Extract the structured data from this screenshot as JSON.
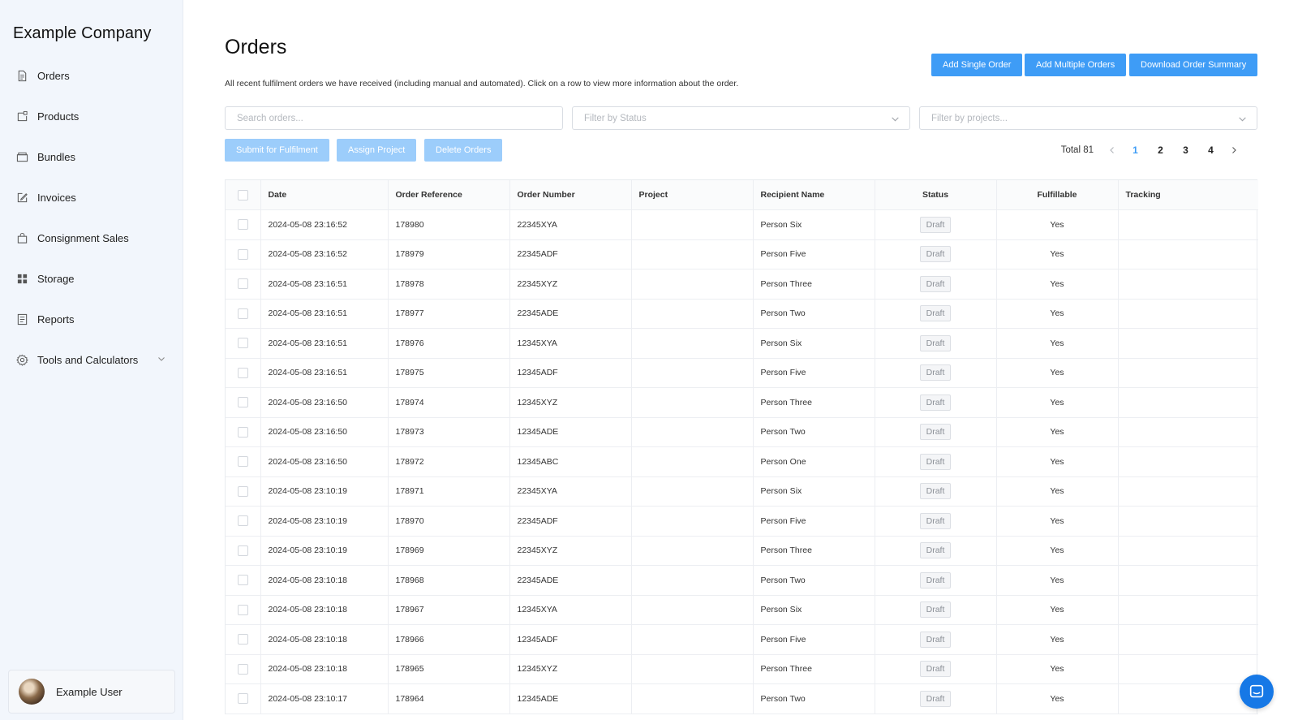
{
  "sidebar": {
    "company": "Example Company",
    "items": [
      {
        "label": "Orders",
        "icon": "document-icon"
      },
      {
        "label": "Products",
        "icon": "product-icon"
      },
      {
        "label": "Bundles",
        "icon": "box-icon"
      },
      {
        "label": "Invoices",
        "icon": "edit-icon"
      },
      {
        "label": "Consignment Sales",
        "icon": "bag-icon"
      },
      {
        "label": "Storage",
        "icon": "grid-icon"
      },
      {
        "label": "Reports",
        "icon": "report-icon"
      },
      {
        "label": "Tools and Calculators",
        "icon": "gear-icon"
      }
    ],
    "user": {
      "name": "Example User"
    }
  },
  "page": {
    "title": "Orders",
    "description": "All recent fulfilment orders we have received (including manual and automated). Click on a row to view more information about the order."
  },
  "actions": {
    "add_single": "Add Single Order",
    "add_multiple": "Add Multiple Orders",
    "download_summary": "Download Order Summary"
  },
  "filters": {
    "search_placeholder": "Search orders...",
    "status_placeholder": "Filter by Status",
    "projects_placeholder": "Filter by projects..."
  },
  "bulk": {
    "submit": "Submit for Fulfilment",
    "assign": "Assign Project",
    "delete": "Delete Orders"
  },
  "pagination": {
    "total": "Total 81",
    "pages": [
      "1",
      "2",
      "3",
      "4"
    ],
    "current": "1"
  },
  "table": {
    "columns": [
      "Date",
      "Order Reference",
      "Order Number",
      "Project",
      "Recipient Name",
      "Status",
      "Fulfillable",
      "Tracking"
    ],
    "rows": [
      {
        "date": "2024-05-08 23:16:52",
        "ref": "178980",
        "number": "22345XYA",
        "project": "",
        "recipient": "Person Six",
        "status": "Draft",
        "fulfillable": "Yes",
        "tracking": ""
      },
      {
        "date": "2024-05-08 23:16:52",
        "ref": "178979",
        "number": "22345ADF",
        "project": "",
        "recipient": "Person Five",
        "status": "Draft",
        "fulfillable": "Yes",
        "tracking": ""
      },
      {
        "date": "2024-05-08 23:16:51",
        "ref": "178978",
        "number": "22345XYZ",
        "project": "",
        "recipient": "Person Three",
        "status": "Draft",
        "fulfillable": "Yes",
        "tracking": ""
      },
      {
        "date": "2024-05-08 23:16:51",
        "ref": "178977",
        "number": "22345ADE",
        "project": "",
        "recipient": "Person Two",
        "status": "Draft",
        "fulfillable": "Yes",
        "tracking": ""
      },
      {
        "date": "2024-05-08 23:16:51",
        "ref": "178976",
        "number": "12345XYA",
        "project": "",
        "recipient": "Person Six",
        "status": "Draft",
        "fulfillable": "Yes",
        "tracking": ""
      },
      {
        "date": "2024-05-08 23:16:51",
        "ref": "178975",
        "number": "12345ADF",
        "project": "",
        "recipient": "Person Five",
        "status": "Draft",
        "fulfillable": "Yes",
        "tracking": ""
      },
      {
        "date": "2024-05-08 23:16:50",
        "ref": "178974",
        "number": "12345XYZ",
        "project": "",
        "recipient": "Person Three",
        "status": "Draft",
        "fulfillable": "Yes",
        "tracking": ""
      },
      {
        "date": "2024-05-08 23:16:50",
        "ref": "178973",
        "number": "12345ADE",
        "project": "",
        "recipient": "Person Two",
        "status": "Draft",
        "fulfillable": "Yes",
        "tracking": ""
      },
      {
        "date": "2024-05-08 23:16:50",
        "ref": "178972",
        "number": "12345ABC",
        "project": "",
        "recipient": "Person One",
        "status": "Draft",
        "fulfillable": "Yes",
        "tracking": ""
      },
      {
        "date": "2024-05-08 23:10:19",
        "ref": "178971",
        "number": "22345XYA",
        "project": "",
        "recipient": "Person Six",
        "status": "Draft",
        "fulfillable": "Yes",
        "tracking": ""
      },
      {
        "date": "2024-05-08 23:10:19",
        "ref": "178970",
        "number": "22345ADF",
        "project": "",
        "recipient": "Person Five",
        "status": "Draft",
        "fulfillable": "Yes",
        "tracking": ""
      },
      {
        "date": "2024-05-08 23:10:19",
        "ref": "178969",
        "number": "22345XYZ",
        "project": "",
        "recipient": "Person Three",
        "status": "Draft",
        "fulfillable": "Yes",
        "tracking": ""
      },
      {
        "date": "2024-05-08 23:10:18",
        "ref": "178968",
        "number": "22345ADE",
        "project": "",
        "recipient": "Person Two",
        "status": "Draft",
        "fulfillable": "Yes",
        "tracking": ""
      },
      {
        "date": "2024-05-08 23:10:18",
        "ref": "178967",
        "number": "12345XYA",
        "project": "",
        "recipient": "Person Six",
        "status": "Draft",
        "fulfillable": "Yes",
        "tracking": ""
      },
      {
        "date": "2024-05-08 23:10:18",
        "ref": "178966",
        "number": "12345ADF",
        "project": "",
        "recipient": "Person Five",
        "status": "Draft",
        "fulfillable": "Yes",
        "tracking": ""
      },
      {
        "date": "2024-05-08 23:10:18",
        "ref": "178965",
        "number": "12345XYZ",
        "project": "",
        "recipient": "Person Three",
        "status": "Draft",
        "fulfillable": "Yes",
        "tracking": ""
      },
      {
        "date": "2024-05-08 23:10:17",
        "ref": "178964",
        "number": "12345ADE",
        "project": "",
        "recipient": "Person Two",
        "status": "Draft",
        "fulfillable": "Yes",
        "tracking": ""
      }
    ]
  },
  "colors": {
    "primary": "#3e9cf6",
    "primary_disabled": "#9ccdfb",
    "sidebar_bg": "#f2f6fc",
    "chat": "#1678e6"
  },
  "chat": {
    "icon": "chat-icon"
  }
}
